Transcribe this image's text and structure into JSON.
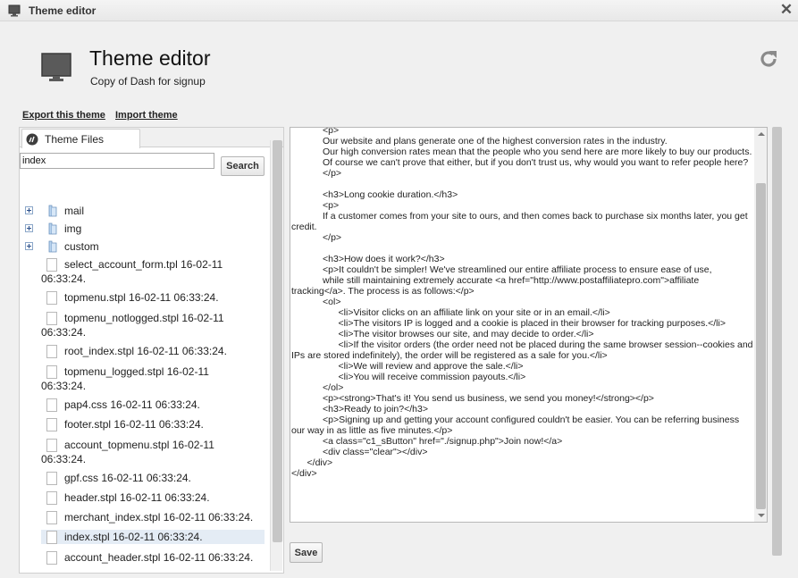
{
  "window": {
    "title": "Theme editor",
    "close_label": "✕"
  },
  "header": {
    "title": "Theme editor",
    "subtitle": "Copy of Dash for signup"
  },
  "links": {
    "export": "Export this theme",
    "import": "Import theme"
  },
  "tabs": [
    {
      "label": "Theme Files"
    }
  ],
  "search": {
    "value": "index",
    "button_label": "Search"
  },
  "tree": {
    "folders": [
      {
        "name": "mail"
      },
      {
        "name": "img"
      },
      {
        "name": "custom"
      }
    ],
    "files": [
      {
        "l1": "select_account_form.tpl   16-02-11",
        "l2": "06:33:24."
      },
      {
        "l1": "topmenu.stpl    16-02-11 06:33:24.",
        "l2": ""
      },
      {
        "l1": "topmenu_notlogged.stpl   16-02-11",
        "l2": "06:33:24."
      },
      {
        "l1": "root_index.stpl    16-02-11 06:33:24.",
        "l2": ""
      },
      {
        "l1": "topmenu_logged.stpl    16-02-11",
        "l2": "06:33:24."
      },
      {
        "l1": "pap4.css    16-02-11 06:33:24.",
        "l2": ""
      },
      {
        "l1": "footer.stpl    16-02-11 06:33:24.",
        "l2": ""
      },
      {
        "l1": "account_topmenu.stpl    16-02-11",
        "l2": "06:33:24."
      },
      {
        "l1": "gpf.css    16-02-11 06:33:24.",
        "l2": ""
      },
      {
        "l1": "header.stpl    16-02-11 06:33:24.",
        "l2": ""
      },
      {
        "l1": "merchant_index.stpl    16-02-11 06:33:24.",
        "l2": ""
      },
      {
        "l1": "index.stpl    16-02-11 06:33:24.",
        "l2": ""
      },
      {
        "l1": "account_header.stpl    16-02-11 06:33:24.",
        "l2": ""
      }
    ]
  },
  "editor": {
    "content": "            <p>\n            Our website and plans generate one of the highest conversion rates in the industry.\n            Our high conversion rates mean that the people who you send here are more likely to buy our products.\n            Of course we can't prove that either, but if you don't trust us, why would you want to refer people here?\n            </p>\n\n            <h3>Long cookie duration.</h3>\n            <p>\n            If a customer comes from your site to ours, and then comes back to purchase six months later, you get credit.\n            </p>\n\n            <h3>How does it work?</h3>\n            <p>It couldn't be simpler! We've streamlined our entire affiliate process to ensure ease of use,\n            while still maintaining extremely accurate <a href=\"http://www.postaffiliatepro.com\">affiliate tracking</a>. The process is as follows:</p>\n            <ol>\n                  <li>Visitor clicks on an affiliate link on your site or in an email.</li>\n                  <li>The visitors IP is logged and a cookie is placed in their browser for tracking purposes.</li>\n                  <li>The visitor browses our site, and may decide to order.</li>\n                  <li>If the visitor orders (the order need not be placed during the same browser session--cookies and IPs are stored indefinitely), the order will be registered as a sale for you.</li>\n                  <li>We will review and approve the sale.</li>\n                  <li>You will receive commission payouts.</li>\n            </ol>\n            <p><strong>That's it! You send us business, we send you money!</strong></p>\n            <h3>Ready to join?</h3>\n            <p>Signing up and getting your account configured couldn't be easier. You can be referring business our way in as little as five minutes.</p>\n            <a class=\"c1_sButton\" href=\"./signup.php\">Join now!</a>\n            <div class=\"clear\"></div>\n      </div>\n</div>"
  },
  "save": {
    "label": "Save"
  }
}
